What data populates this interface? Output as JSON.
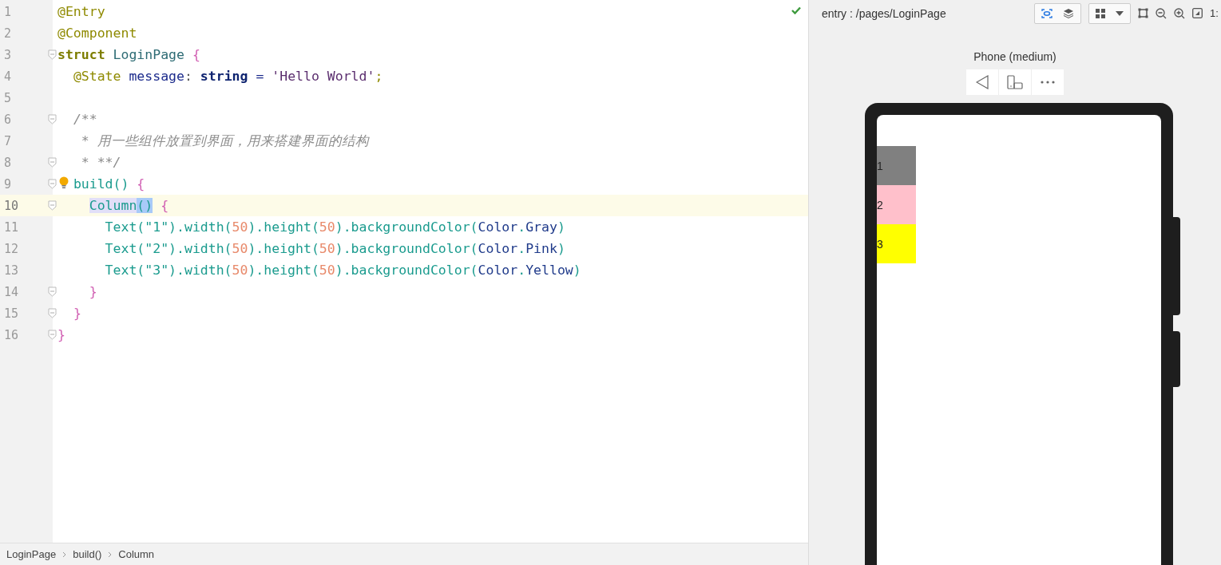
{
  "editor": {
    "lines": [
      {
        "number": "1",
        "fold": false,
        "bulb": false,
        "current": false,
        "tokens": [
          {
            "text": "@Entry",
            "kind": "annotation"
          }
        ]
      },
      {
        "number": "2",
        "fold": false,
        "bulb": false,
        "current": false,
        "tokens": [
          {
            "text": "@Component",
            "kind": "annotation"
          }
        ]
      },
      {
        "number": "3",
        "fold": true,
        "bulb": false,
        "current": false,
        "tokens": [
          {
            "text": "struct",
            "kind": "keyword"
          },
          {
            "text": " LoginPage ",
            "kind": "class"
          },
          {
            "text": "{",
            "kind": "brace"
          }
        ]
      },
      {
        "number": "4",
        "fold": false,
        "bulb": false,
        "current": false,
        "tokens": [
          {
            "text": "  @State",
            "kind": "annotation"
          },
          {
            "text": " message",
            "kind": "field"
          },
          {
            "text": ": ",
            "kind": "plain"
          },
          {
            "text": "string",
            "kind": "type"
          },
          {
            "text": " = ",
            "kind": "field"
          },
          {
            "text": "'Hello World'",
            "kind": "string"
          },
          {
            "text": ";",
            "kind": "annotation"
          }
        ]
      },
      {
        "number": "5",
        "fold": false,
        "bulb": false,
        "current": false
      },
      {
        "number": "6",
        "fold": true,
        "bulb": false,
        "current": false,
        "tokens": [
          {
            "text": "  /**",
            "kind": "comment"
          }
        ]
      },
      {
        "number": "7",
        "fold": false,
        "bulb": false,
        "current": false,
        "tokens": [
          {
            "text": "   * 用一些组件放置到界面，用来搭建界面的结构",
            "kind": "comment"
          }
        ]
      },
      {
        "number": "8",
        "fold": true,
        "bulb": false,
        "current": false,
        "tokens": [
          {
            "text": "   * **/",
            "kind": "comment"
          }
        ]
      },
      {
        "number": "9",
        "fold": true,
        "bulb": true,
        "current": false,
        "tokens": [
          {
            "text": "  build() ",
            "kind": "call"
          },
          {
            "text": "{",
            "kind": "brace"
          }
        ]
      },
      {
        "number": "10",
        "fold": true,
        "bulb": false,
        "current": true,
        "tokens": [
          {
            "text": "    Column",
            "kind": "match-name"
          },
          {
            "text": "()",
            "kind": "match-paren"
          },
          {
            "text": " {",
            "kind": "brace"
          }
        ]
      },
      {
        "number": "11",
        "fold": false,
        "bulb": false,
        "current": false,
        "tokens": [
          {
            "text": "      Text(\"1\")",
            "kind": "call"
          },
          {
            "text": ".width(",
            "kind": "call"
          },
          {
            "text": "50",
            "kind": "number"
          },
          {
            "text": ").height(",
            "kind": "call"
          },
          {
            "text": "50",
            "kind": "number"
          },
          {
            "text": ").backgroundColor(",
            "kind": "call"
          },
          {
            "text": "Color",
            "kind": "enum"
          },
          {
            "text": ".",
            "kind": "call"
          },
          {
            "text": "Gray",
            "kind": "enum"
          },
          {
            "text": ")",
            "kind": "call"
          }
        ]
      },
      {
        "number": "12",
        "fold": false,
        "bulb": false,
        "current": false,
        "tokens": [
          {
            "text": "      Text(\"2\")",
            "kind": "call"
          },
          {
            "text": ".width(",
            "kind": "call"
          },
          {
            "text": "50",
            "kind": "number"
          },
          {
            "text": ").height(",
            "kind": "call"
          },
          {
            "text": "50",
            "kind": "number"
          },
          {
            "text": ").backgroundColor(",
            "kind": "call"
          },
          {
            "text": "Color",
            "kind": "enum"
          },
          {
            "text": ".",
            "kind": "call"
          },
          {
            "text": "Pink",
            "kind": "enum"
          },
          {
            "text": ")",
            "kind": "call"
          }
        ]
      },
      {
        "number": "13",
        "fold": false,
        "bulb": false,
        "current": false,
        "tokens": [
          {
            "text": "      Text(\"3\")",
            "kind": "call"
          },
          {
            "text": ".width(",
            "kind": "call"
          },
          {
            "text": "50",
            "kind": "number"
          },
          {
            "text": ").height(",
            "kind": "call"
          },
          {
            "text": "50",
            "kind": "number"
          },
          {
            "text": ").backgroundColor(",
            "kind": "call"
          },
          {
            "text": "Color",
            "kind": "enum"
          },
          {
            "text": ".",
            "kind": "call"
          },
          {
            "text": "Yellow",
            "kind": "enum"
          },
          {
            "text": ")",
            "kind": "call"
          }
        ]
      },
      {
        "number": "14",
        "fold": true,
        "bulb": false,
        "current": false,
        "tokens": [
          {
            "text": "    }",
            "kind": "brace"
          }
        ]
      },
      {
        "number": "15",
        "fold": true,
        "bulb": false,
        "current": false,
        "tokens": [
          {
            "text": "  }",
            "kind": "brace"
          }
        ]
      },
      {
        "number": "16",
        "fold": true,
        "bulb": false,
        "current": false,
        "tokens": [
          {
            "text": "}",
            "kind": "brace"
          }
        ]
      }
    ],
    "breadcrumbs": [
      "LoginPage",
      "build()",
      "Column"
    ]
  },
  "previewer": {
    "path": "entry : /pages/LoginPage",
    "zoom_label": "1:",
    "device": "Phone (medium)",
    "screen_items": [
      {
        "text": "1",
        "color": "#808080"
      },
      {
        "text": "2",
        "color": "#ffc0cb"
      },
      {
        "text": "3",
        "color": "#ffff00"
      }
    ]
  }
}
